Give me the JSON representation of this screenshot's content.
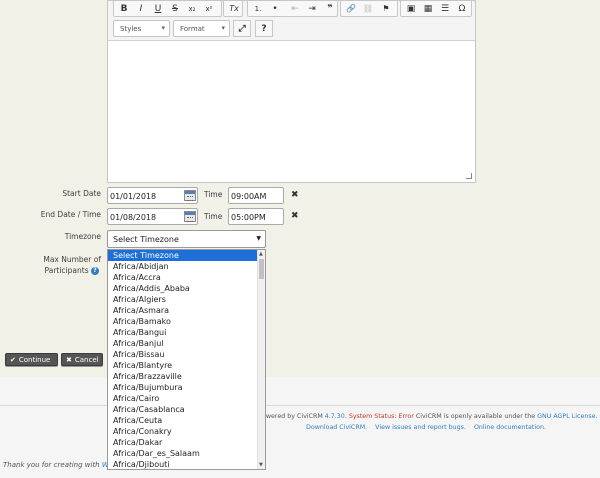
{
  "editor": {
    "toolbar_row1": [
      "B",
      "I",
      "U",
      "S",
      "x₂",
      "x²",
      "Tx",
      "1.",
      "•",
      "⇤",
      "⇥",
      "❞",
      "🔗",
      "⛓",
      "⚑",
      "▣",
      "▦",
      "☰",
      "Ω"
    ],
    "styles_label": "Styles",
    "format_label": "Format",
    "maximize_icon": "⤢",
    "help_label": "?"
  },
  "form": {
    "start_date": {
      "label": "Start Date",
      "date": "01/01/2018",
      "time_label": "Time",
      "time": "09:00AM",
      "clear": "✖"
    },
    "end_date": {
      "label": "End Date / Time",
      "date": "01/08/2018",
      "time_label": "Time",
      "time": "05:00PM",
      "clear": "✖"
    },
    "timezone": {
      "label": "Timezone",
      "selected": "Select Timezone"
    },
    "max_participants": {
      "label_line1": "Max Number of",
      "label_line2": "Participants"
    }
  },
  "timezone_options": [
    "Select Timezone",
    "Africa/Abidjan",
    "Africa/Accra",
    "Africa/Addis_Ababa",
    "Africa/Algiers",
    "Africa/Asmara",
    "Africa/Bamako",
    "Africa/Bangui",
    "Africa/Banjul",
    "Africa/Bissau",
    "Africa/Blantyre",
    "Africa/Brazzaville",
    "Africa/Bujumbura",
    "Africa/Cairo",
    "Africa/Casablanca",
    "Africa/Ceuta",
    "Africa/Conakry",
    "Africa/Dakar",
    "Africa/Dar_es_Salaam",
    "Africa/Djibouti"
  ],
  "buttons": {
    "continue": "Continue",
    "cancel": "Cancel"
  },
  "footer": {
    "powered_prefix": "owered by CiviCRM",
    "version": "4.7.30",
    "status": "System Status: Error",
    "available": "CiviCRM is openly available under the",
    "license": "GNU AGPL License.",
    "download": "Download CiviCRM.",
    "issues": "View issues and report bugs.",
    "docs": "Online documentation.",
    "thanks": "Thank you for creating with",
    "thanks_link": "W"
  },
  "colors": {
    "accent": "#2f7fc2",
    "selected_option": "#1e6fd9",
    "error": "#c0392b"
  }
}
